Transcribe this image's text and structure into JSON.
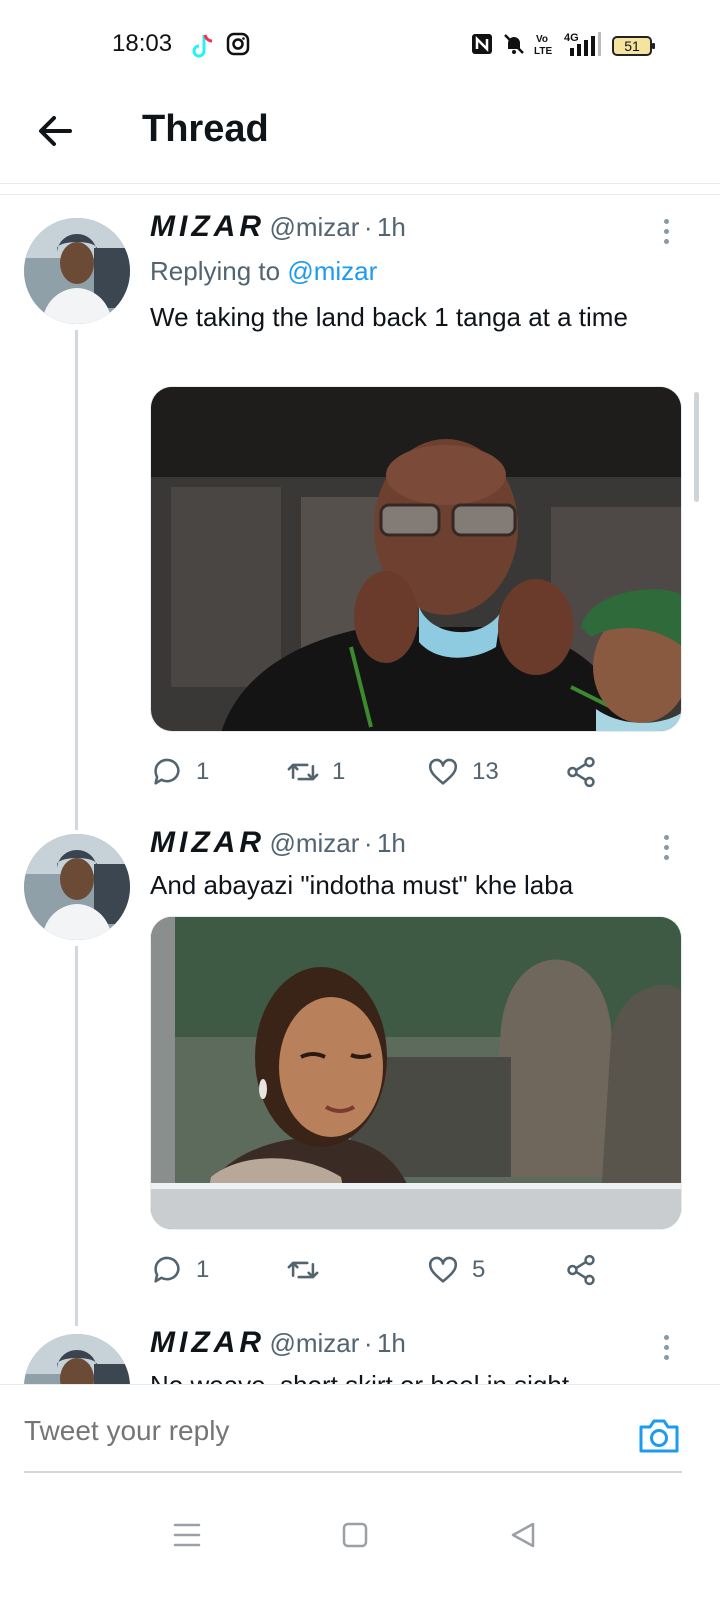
{
  "status_bar": {
    "time": "18:03",
    "battery": "51",
    "network": "4G",
    "icons": [
      "tiktok-icon",
      "instagram-icon",
      "nfc-icon",
      "mute-icon",
      "volte-icon",
      "signal-icon",
      "battery-icon"
    ]
  },
  "header": {
    "title": "Thread",
    "back_icon": "arrow-left-icon"
  },
  "tweets": [
    {
      "display_name": "MIZAR",
      "handle": "@mizar",
      "separator": "·",
      "time": "1h",
      "replying_label": "Replying to ",
      "replying_handle": "@mizar",
      "text": "We taking the land back 1 tanga at a time",
      "media_icon": "photo-elderly-man-adjusting-mask",
      "replies": "1",
      "retweets": "1",
      "likes": "13"
    },
    {
      "display_name": "MIZAR",
      "handle": "@mizar",
      "separator": "·",
      "time": "1h",
      "text": "And abayazi \"indotha must\" khe laba",
      "media_icon": "photo-woman-winking-in-car",
      "replies": "1",
      "retweets": "",
      "likes": "5"
    },
    {
      "display_name": "MIZAR",
      "handle": "@mizar",
      "separator": "·",
      "time": "1h",
      "text": "No weave, short skirt or heel in sight"
    }
  ],
  "reply_bar": {
    "placeholder": "Tweet your reply",
    "icon": "camera-icon"
  },
  "nav_bar": {
    "icons": [
      "menu-icon",
      "home-square-icon",
      "back-triangle-icon"
    ]
  },
  "colors": {
    "accent": "#1d9bf0",
    "text": "#0f1419",
    "secondary": "#536471",
    "thread_line": "#cfd9de"
  }
}
